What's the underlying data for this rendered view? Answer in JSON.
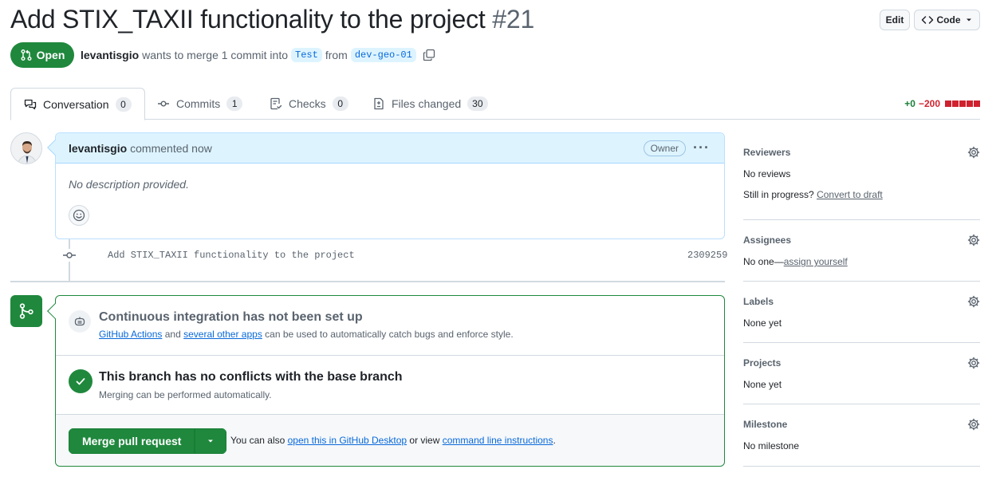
{
  "title": {
    "text": "Add STIX_TAXII functionality to the project",
    "number": "#21"
  },
  "header_buttons": {
    "edit": "Edit",
    "code": "Code"
  },
  "state": {
    "label": "Open"
  },
  "meta": {
    "author": "levantisgio",
    "text": "wants to merge 1 commit into",
    "base_branch": "Test",
    "from_text": "from",
    "head_branch": "dev-geo-01"
  },
  "tabs": [
    {
      "label": "Conversation",
      "count": "0"
    },
    {
      "label": "Commits",
      "count": "1"
    },
    {
      "label": "Checks",
      "count": "0"
    },
    {
      "label": "Files changed",
      "count": "30"
    }
  ],
  "diffstat": {
    "additions": "+0",
    "deletions": "−200"
  },
  "comment": {
    "author": "levantisgio",
    "action": "commented now",
    "role": "Owner",
    "body": "No description provided."
  },
  "commit": {
    "message": "Add STIX_TAXII functionality to the project",
    "sha": "2309259"
  },
  "merge": {
    "ci_title": "Continuous integration has not been set up",
    "ci_link1": "GitHub Actions",
    "ci_and": "and",
    "ci_link2": "several other apps",
    "ci_rest": "can be used to automatically catch bugs and enforce style.",
    "nc_title": "This branch has no conflicts with the base branch",
    "nc_sub": "Merging can be performed automatically.",
    "merge_button": "Merge pull request",
    "also_prefix": "You can also",
    "also_link1": "open this in GitHub Desktop",
    "also_mid": "or view",
    "also_link2": "command line instructions",
    "also_end": "."
  },
  "sidebar": {
    "reviewers": {
      "title": "Reviewers",
      "value": "No reviews",
      "progress_text": "Still in progress?",
      "progress_link": "Convert to draft"
    },
    "assignees": {
      "title": "Assignees",
      "value": "No one—",
      "link": "assign yourself"
    },
    "labels": {
      "title": "Labels",
      "value": "None yet"
    },
    "projects": {
      "title": "Projects",
      "value": "None yet"
    },
    "milestone": {
      "title": "Milestone",
      "value": "No milestone"
    }
  },
  "colors": {
    "accent": "#0969da",
    "success": "#1f883d",
    "danger": "#cf222e"
  }
}
